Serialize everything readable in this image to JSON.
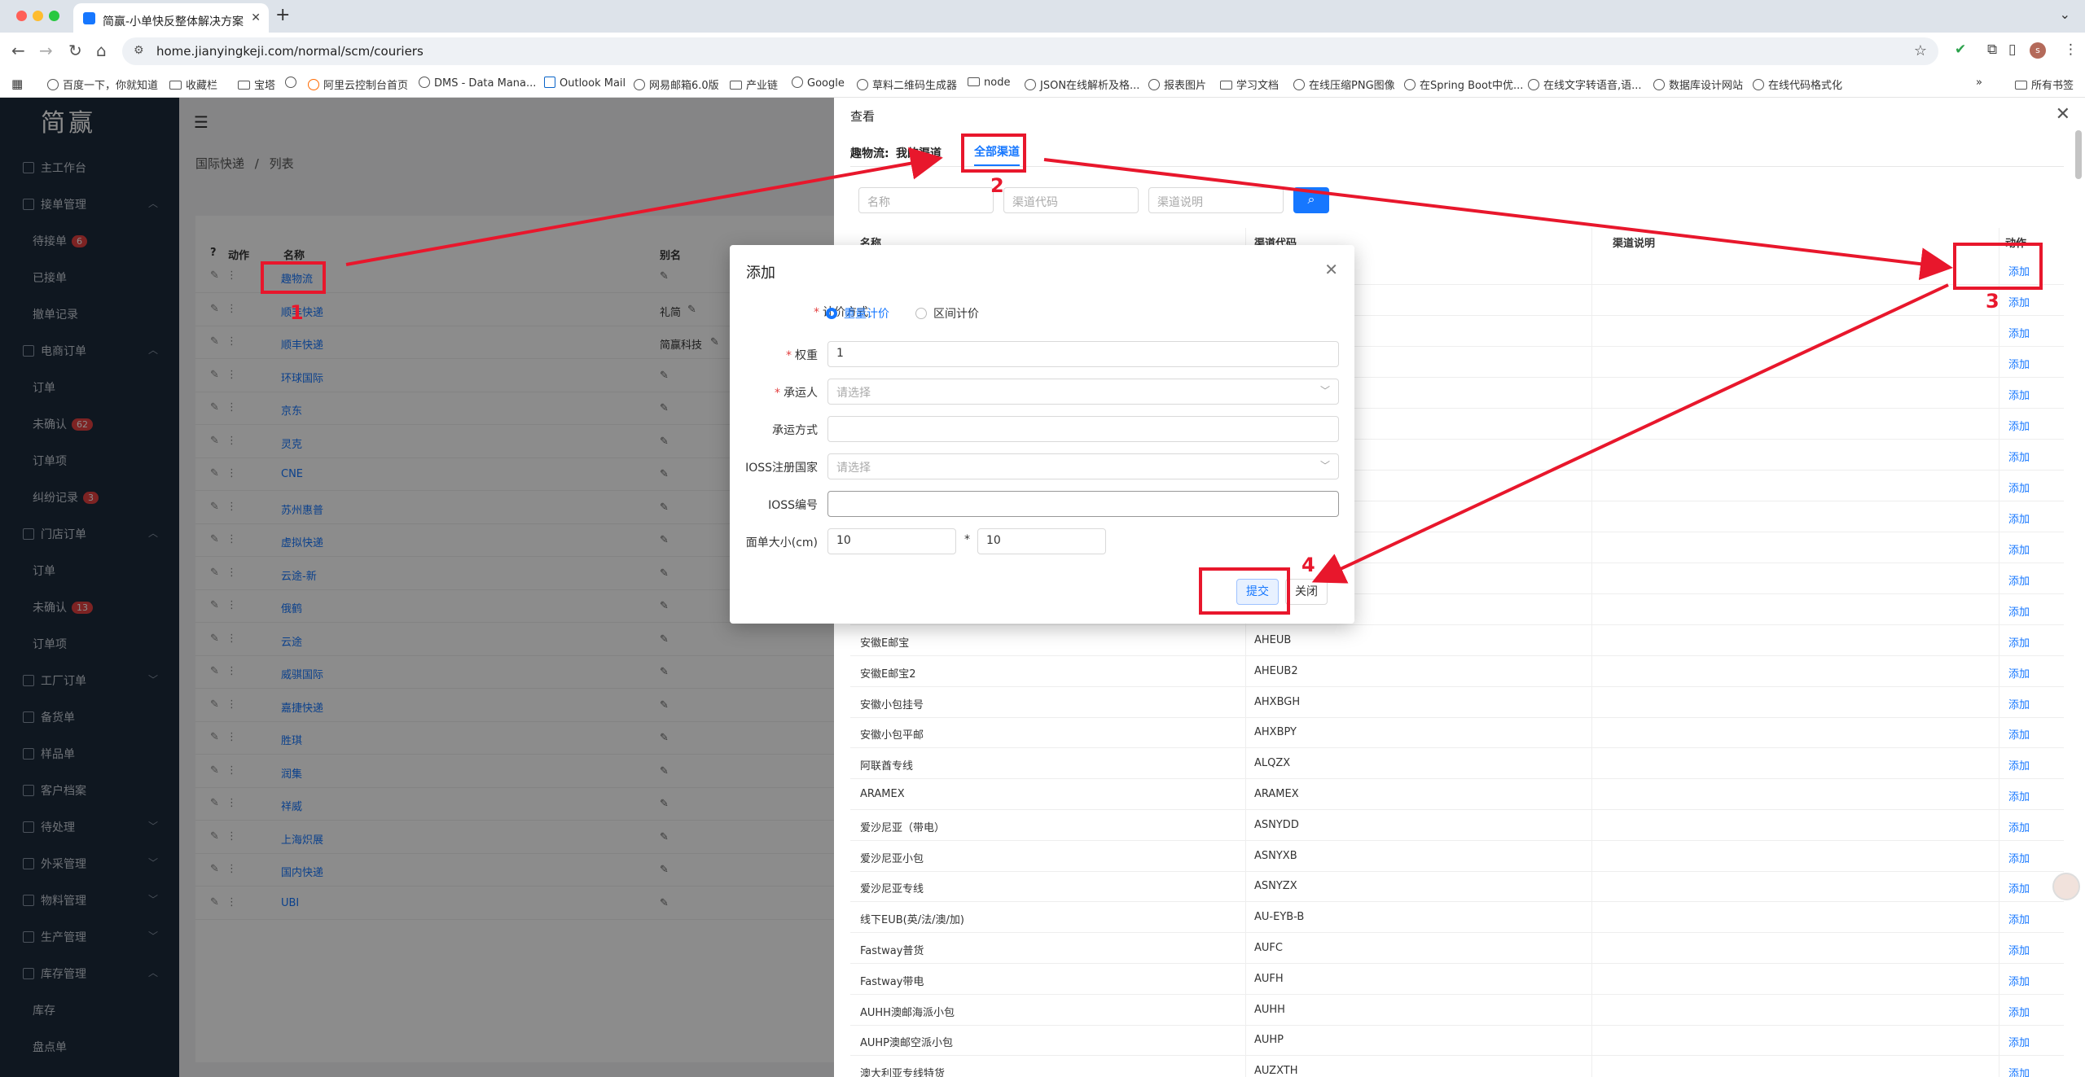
{
  "browser": {
    "tab_title": "简赢-小单快反整体解决方案",
    "url": "home.jianyingkeji.com/normal/scm/couriers",
    "profile_initial": "s",
    "bookmarks": [
      "百度一下，你就知道",
      "收藏栏",
      "宝塔",
      "",
      "阿里云控制台首页",
      "DMS - Data Mana...",
      "Outlook Mail",
      "网易邮箱6.0版",
      "产业链",
      "Google",
      "草料二维码生成器",
      "node",
      "JSON在线解析及格...",
      "报表图片",
      "学习文档",
      "在线压缩PNG图像",
      "在Spring Boot中优...",
      "在线文字转语音,语...",
      "数据库设计网站",
      "在线代码格式化"
    ],
    "all_bookmarks": "所有书签"
  },
  "app": {
    "logo": "简赢",
    "sidebar": [
      {
        "label": "主工作台",
        "level": 0
      },
      {
        "label": "接单管理",
        "level": 0,
        "chev": "︿"
      },
      {
        "label": "待接单",
        "level": 1,
        "badge": "6"
      },
      {
        "label": "已接单",
        "level": 1
      },
      {
        "label": "撤单记录",
        "level": 1
      },
      {
        "label": "电商订单",
        "level": 0,
        "chev": "︿"
      },
      {
        "label": "订单",
        "level": 1
      },
      {
        "label": "未确认",
        "level": 1,
        "badge": "62"
      },
      {
        "label": "订单项",
        "level": 1
      },
      {
        "label": "纠纷记录",
        "level": 1,
        "badge": "3"
      },
      {
        "label": "门店订单",
        "level": 0,
        "chev": "︿"
      },
      {
        "label": "订单",
        "level": 1
      },
      {
        "label": "未确认",
        "level": 1,
        "badge": "13"
      },
      {
        "label": "订单项",
        "level": 1
      },
      {
        "label": "工厂订单",
        "level": 0,
        "chev": "﹀"
      },
      {
        "label": "备货单",
        "level": 0
      },
      {
        "label": "样品单",
        "level": 0
      },
      {
        "label": "客户档案",
        "level": 0
      },
      {
        "label": "待处理",
        "level": 0,
        "chev": "﹀"
      },
      {
        "label": "外采管理",
        "level": 0,
        "chev": "﹀"
      },
      {
        "label": "物料管理",
        "level": 0,
        "chev": "﹀"
      },
      {
        "label": "生产管理",
        "level": 0,
        "chev": "﹀"
      },
      {
        "label": "库存管理",
        "level": 0,
        "chev": "︿"
      },
      {
        "label": "库存",
        "level": 1
      },
      {
        "label": "盘点单",
        "level": 1
      }
    ],
    "breadcrumb": {
      "parent": "国际快递",
      "sep": "/",
      "current": "列表"
    },
    "list": {
      "headers": {
        "action": "动作",
        "name": "名称",
        "alias": "别名"
      },
      "rows": [
        {
          "name": "趣物流",
          "alias": ""
        },
        {
          "name": "顺丰快递",
          "alias": "礼简"
        },
        {
          "name": "顺丰快递",
          "alias": "简赢科技"
        },
        {
          "name": "环球国际",
          "alias": ""
        },
        {
          "name": "京东",
          "alias": ""
        },
        {
          "name": "灵克",
          "alias": ""
        },
        {
          "name": "CNE",
          "alias": ""
        },
        {
          "name": "苏州惠普",
          "alias": ""
        },
        {
          "name": "虚拟快递",
          "alias": ""
        },
        {
          "name": "云途-新",
          "alias": ""
        },
        {
          "name": "俄鹤",
          "alias": ""
        },
        {
          "name": "云途",
          "alias": ""
        },
        {
          "name": "威骐国际",
          "alias": ""
        },
        {
          "name": "嘉捷快递",
          "alias": ""
        },
        {
          "name": "胜琪",
          "alias": ""
        },
        {
          "name": "润集",
          "alias": ""
        },
        {
          "name": "祥威",
          "alias": ""
        },
        {
          "name": "上海炽展",
          "alias": ""
        },
        {
          "name": "国内快递",
          "alias": ""
        },
        {
          "name": "UBI",
          "alias": ""
        }
      ]
    }
  },
  "drawer": {
    "title": "查看",
    "tab_prefix": "趣物流:",
    "tab_mine": "我的渠道",
    "tab_all": "全部渠道",
    "search": {
      "name_ph": "名称",
      "code_ph": "渠道代码",
      "desc_ph": "渠道说明"
    },
    "headers": {
      "name": "名称",
      "code": "渠道代码",
      "desc": "渠道说明",
      "action": "动作"
    },
    "add_label": "添加",
    "rows": [
      {
        "name": "安徽E邮宝",
        "code": "AHEUB"
      },
      {
        "name": "安徽E邮宝2",
        "code": "AHEUB2"
      },
      {
        "name": "安徽小包挂号",
        "code": "AHXBGH"
      },
      {
        "name": "安徽小包平邮",
        "code": "AHXBPY"
      },
      {
        "name": "阿联酋专线",
        "code": "ALQZX"
      },
      {
        "name": "ARAMEX",
        "code": "ARAMEX"
      },
      {
        "name": "爱沙尼亚（带电）",
        "code": "ASNYDD"
      },
      {
        "name": "爱沙尼亚小包",
        "code": "ASNYXB"
      },
      {
        "name": "爱沙尼亚专线",
        "code": "ASNYZX"
      },
      {
        "name": "线下EUB(英/法/澳/加)",
        "code": "AU-EYB-B"
      },
      {
        "name": "Fastway普货",
        "code": "AUFC"
      },
      {
        "name": "Fastway带电",
        "code": "AUFH"
      },
      {
        "name": "AUHH澳邮海派小包",
        "code": "AUHH"
      },
      {
        "name": "AUHP澳邮空派小包",
        "code": "AUHP"
      },
      {
        "name": "澳大利亚专线特货",
        "code": "AUZXTH"
      }
    ]
  },
  "modal": {
    "title": "添加",
    "pricing_label": "计价方式",
    "pricing_opt1": "重量计价",
    "pricing_opt2": "区间计价",
    "weight_label": "权重",
    "weight_value": "1",
    "carrier_label": "承运人",
    "carrier_ph": "请选择",
    "method_label": "承运方式",
    "method_value": "",
    "ioss_country_label": "IOSS注册国家",
    "ioss_country_ph": "请选择",
    "ioss_no_label": "IOSS编号",
    "ioss_no_value": "",
    "size_label": "面单大小(cm)",
    "size_w": "10",
    "size_times": "*",
    "size_h": "10",
    "submit": "提交",
    "close": "关闭"
  },
  "annotations": {
    "n1": "1",
    "n2": "2",
    "n3": "3",
    "n4": "4",
    "color": "#e8172c"
  }
}
